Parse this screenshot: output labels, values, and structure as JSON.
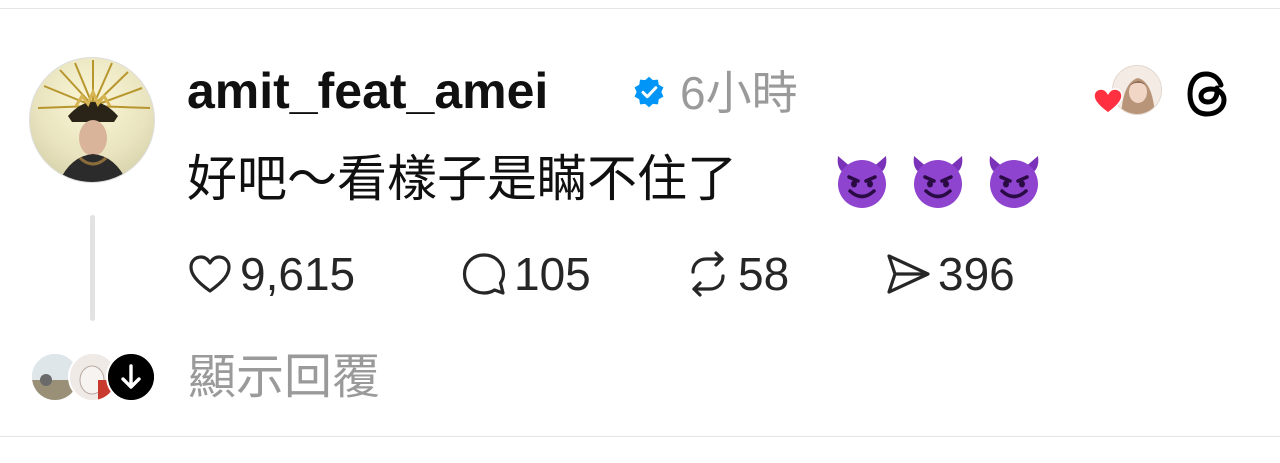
{
  "post": {
    "username": "amit_feat_amei",
    "verified": true,
    "timestamp": "6小時",
    "text": "好吧～看樣子是瞞不住了",
    "emojis": [
      "smiling-devil-emoji",
      "smiling-devil-emoji",
      "smiling-devil-emoji"
    ],
    "stats": {
      "likes": "9,615",
      "comments": "105",
      "reposts": "58",
      "shares": "396"
    },
    "show_replies_label": "顯示回覆"
  },
  "colors": {
    "verified_blue": "#0095f6",
    "heart_red": "#ff3040",
    "devil_purple": "#8a3fc8",
    "muted_text": "#9a9a9a"
  }
}
